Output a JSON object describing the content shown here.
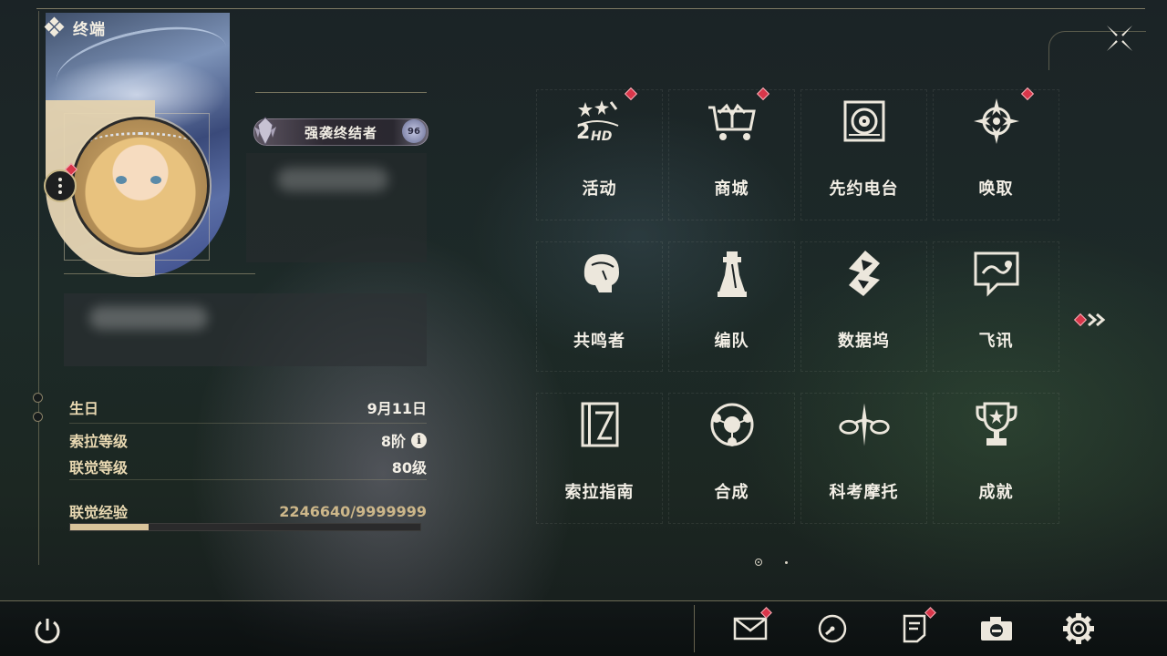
{
  "header": {
    "title": "终端"
  },
  "profile": {
    "title_badge": "强袭终结者",
    "title_badge_emblem": "96"
  },
  "stats": {
    "birthday_label": "生日",
    "birthday_value": "9月11日",
    "sola_level_label": "索拉等级",
    "sola_level_value": "8阶",
    "union_level_label": "联觉等级",
    "union_level_value": "80级",
    "union_exp_label": "联觉经验",
    "union_exp_value": "2246640/9999999",
    "union_exp_progress": 0.2247
  },
  "menu": {
    "items": [
      {
        "label": "活动",
        "icon": "event-icon",
        "badge": true
      },
      {
        "label": "商城",
        "icon": "shop-cart-icon",
        "badge": true
      },
      {
        "label": "先约电台",
        "icon": "radio-icon",
        "badge": false
      },
      {
        "label": "唤取",
        "icon": "convene-compass-icon",
        "badge": true
      },
      {
        "label": "共鸣者",
        "icon": "resonator-icon",
        "badge": false
      },
      {
        "label": "编队",
        "icon": "team-chess-icon",
        "badge": false
      },
      {
        "label": "数据坞",
        "icon": "data-bank-icon",
        "badge": false
      },
      {
        "label": "飞讯",
        "icon": "message-chat-icon",
        "badge": false
      },
      {
        "label": "索拉指南",
        "icon": "guidebook-icon",
        "badge": false
      },
      {
        "label": "合成",
        "icon": "synthesis-icon",
        "badge": false
      },
      {
        "label": "科考摩托",
        "icon": "motorbike-icon",
        "badge": false
      },
      {
        "label": "成就",
        "icon": "trophy-icon",
        "badge": false
      }
    ]
  },
  "bottom_bar": {
    "icons": [
      "power-icon",
      "mail-icon",
      "clock-icon",
      "notice-icon",
      "camera-icon",
      "settings-gear-icon"
    ]
  },
  "colors": {
    "accent_gold": "#d9c49a",
    "badge_red": "#d9364a",
    "text_light": "#f3efe6"
  }
}
